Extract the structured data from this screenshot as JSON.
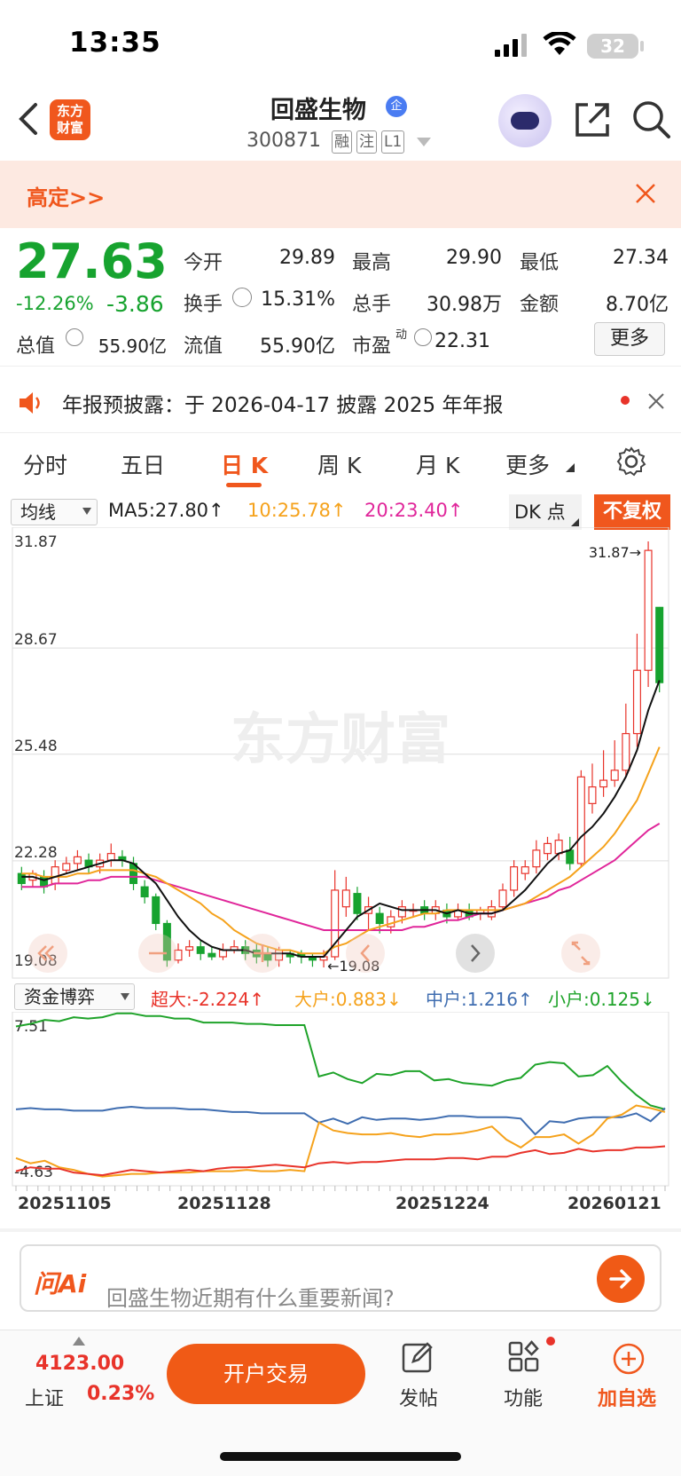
{
  "status_bar": {
    "time": "13:35",
    "battery": "32"
  },
  "header": {
    "logo_text_1": "东方",
    "logo_text_2": "财富",
    "stock_name": "回盛生物",
    "name_badge": "企",
    "stock_code": "300871",
    "tags": [
      "融",
      "注",
      "L1"
    ]
  },
  "banner": {
    "text": "高定>>"
  },
  "quote": {
    "price": "27.63",
    "change_pct": "-12.26%",
    "change": "-3.86",
    "fields": {
      "open_label": "今开",
      "open": "29.89",
      "high_label": "最高",
      "high": "29.90",
      "low_label": "最低",
      "low": "27.34",
      "turnover_label": "换手",
      "turnover": "15.31%",
      "volume_label": "总手",
      "volume": "30.98万",
      "amount_label": "金额",
      "amount": "8.70亿",
      "mcap_label": "总值",
      "mcap": "55.90亿",
      "float_label": "流值",
      "float": "55.90亿",
      "pe_label": "市盈",
      "pe_sup": "动",
      "pe": "22.31"
    },
    "more_button": "更多"
  },
  "notice": {
    "text": "年报预披露：于 2026-04-17 披露 2025 年年报"
  },
  "tabs": [
    "分时",
    "五日",
    "日 K",
    "周 K",
    "月 K",
    "更多"
  ],
  "active_tab": "日 K",
  "kline_toolbar": {
    "ma_select": "均线",
    "ma5": "MA5:27.80↑",
    "ma10": "10:25.78↑",
    "ma20": "20:23.40↑",
    "dk_button": "DK 点",
    "fq_button": "不复权"
  },
  "flow_toolbar": {
    "select": "资金博弈",
    "super": "超大:-2.224↑",
    "large": "大户:0.883↓",
    "medium": "中户:1.216↑",
    "small": "小户:0.125↓"
  },
  "watermark": "东方财富",
  "chart_data": [
    {
      "type": "candlestick",
      "y_ticks": [
        "31.87",
        "28.67",
        "25.48",
        "22.28",
        "19.08"
      ],
      "ylim": [
        19.08,
        31.87
      ],
      "max_label": "31.87→",
      "min_label": "←19.08",
      "candles": [
        {
          "o": 21.9,
          "c": 21.6,
          "h": 22.1,
          "l": 21.4
        },
        {
          "o": 21.7,
          "c": 21.9,
          "h": 22.0,
          "l": 21.5
        },
        {
          "o": 21.8,
          "c": 21.5,
          "h": 22.0,
          "l": 21.3
        },
        {
          "o": 21.6,
          "c": 22.1,
          "h": 22.3,
          "l": 21.4
        },
        {
          "o": 22.0,
          "c": 22.2,
          "h": 22.4,
          "l": 21.9
        },
        {
          "o": 22.2,
          "c": 22.4,
          "h": 22.6,
          "l": 22.0
        },
        {
          "o": 22.3,
          "c": 22.1,
          "h": 22.5,
          "l": 21.9
        },
        {
          "o": 22.1,
          "c": 22.3,
          "h": 22.5,
          "l": 21.9
        },
        {
          "o": 22.3,
          "c": 22.5,
          "h": 22.8,
          "l": 22.1
        },
        {
          "o": 22.4,
          "c": 22.3,
          "h": 22.6,
          "l": 22.1
        },
        {
          "o": 22.2,
          "c": 21.6,
          "h": 22.4,
          "l": 21.4
        },
        {
          "o": 21.5,
          "c": 21.2,
          "h": 21.7,
          "l": 21.0
        },
        {
          "o": 21.2,
          "c": 20.4,
          "h": 21.3,
          "l": 20.2
        },
        {
          "o": 20.4,
          "c": 19.3,
          "h": 20.5,
          "l": 19.1
        },
        {
          "o": 19.3,
          "c": 19.6,
          "h": 19.8,
          "l": 19.2
        },
        {
          "o": 19.6,
          "c": 19.7,
          "h": 19.9,
          "l": 19.4
        },
        {
          "o": 19.7,
          "c": 19.5,
          "h": 19.9,
          "l": 19.3
        },
        {
          "o": 19.5,
          "c": 19.4,
          "h": 19.7,
          "l": 19.3
        },
        {
          "o": 19.4,
          "c": 19.6,
          "h": 19.8,
          "l": 19.3
        },
        {
          "o": 19.6,
          "c": 19.7,
          "h": 19.9,
          "l": 19.5
        },
        {
          "o": 19.7,
          "c": 19.5,
          "h": 19.9,
          "l": 19.3
        },
        {
          "o": 19.6,
          "c": 19.4,
          "h": 19.8,
          "l": 19.2
        },
        {
          "o": 19.5,
          "c": 19.3,
          "h": 19.7,
          "l": 19.1
        },
        {
          "o": 19.3,
          "c": 19.6,
          "h": 19.7,
          "l": 19.1
        },
        {
          "o": 19.5,
          "c": 19.4,
          "h": 19.6,
          "l": 19.2
        },
        {
          "o": 19.5,
          "c": 19.4,
          "h": 19.6,
          "l": 19.2
        },
        {
          "o": 19.4,
          "c": 19.3,
          "h": 19.5,
          "l": 19.1
        },
        {
          "o": 19.3,
          "c": 19.4,
          "h": 19.6,
          "l": 19.08
        },
        {
          "o": 19.4,
          "c": 21.4,
          "h": 22.0,
          "l": 19.3
        },
        {
          "o": 20.9,
          "c": 21.4,
          "h": 21.8,
          "l": 20.6
        },
        {
          "o": 21.3,
          "c": 20.7,
          "h": 21.5,
          "l": 20.5
        },
        {
          "o": 20.7,
          "c": 20.9,
          "h": 21.2,
          "l": 20.2
        },
        {
          "o": 20.7,
          "c": 20.4,
          "h": 20.9,
          "l": 20.1
        },
        {
          "o": 20.3,
          "c": 20.6,
          "h": 20.8,
          "l": 20.1
        },
        {
          "o": 20.6,
          "c": 20.9,
          "h": 21.1,
          "l": 20.4
        },
        {
          "o": 20.8,
          "c": 20.8,
          "h": 21.0,
          "l": 20.6
        },
        {
          "o": 20.9,
          "c": 20.7,
          "h": 21.1,
          "l": 20.5
        },
        {
          "o": 20.7,
          "c": 20.9,
          "h": 21.1,
          "l": 20.5
        },
        {
          "o": 20.8,
          "c": 20.6,
          "h": 21.0,
          "l": 20.4
        },
        {
          "o": 20.6,
          "c": 20.8,
          "h": 21.0,
          "l": 20.5
        },
        {
          "o": 20.8,
          "c": 20.6,
          "h": 21.0,
          "l": 20.5
        },
        {
          "o": 20.7,
          "c": 20.8,
          "h": 20.9,
          "l": 20.5
        },
        {
          "o": 20.6,
          "c": 20.9,
          "h": 21.1,
          "l": 20.5
        },
        {
          "o": 20.9,
          "c": 21.4,
          "h": 21.6,
          "l": 20.8
        },
        {
          "o": 21.4,
          "c": 22.1,
          "h": 22.3,
          "l": 21.2
        },
        {
          "o": 21.9,
          "c": 22.1,
          "h": 22.3,
          "l": 21.7
        },
        {
          "o": 22.1,
          "c": 22.6,
          "h": 22.9,
          "l": 21.9
        },
        {
          "o": 22.5,
          "c": 22.8,
          "h": 23.0,
          "l": 22.3
        },
        {
          "o": 22.5,
          "c": 22.9,
          "h": 23.1,
          "l": 22.3
        },
        {
          "o": 22.6,
          "c": 22.2,
          "h": 23.0,
          "l": 22.0
        },
        {
          "o": 22.2,
          "c": 24.8,
          "h": 25.0,
          "l": 22.1
        },
        {
          "o": 24.0,
          "c": 24.5,
          "h": 25.2,
          "l": 23.7
        },
        {
          "o": 24.5,
          "c": 24.7,
          "h": 25.6,
          "l": 24.2
        },
        {
          "o": 24.7,
          "c": 25.0,
          "h": 25.9,
          "l": 24.5
        },
        {
          "o": 25.0,
          "c": 26.1,
          "h": 27.0,
          "l": 24.8
        },
        {
          "o": 26.1,
          "c": 28.0,
          "h": 29.1,
          "l": 25.7
        },
        {
          "o": 28.0,
          "c": 31.6,
          "h": 31.87,
          "l": 27.5
        },
        {
          "o": 29.89,
          "c": 27.63,
          "h": 29.9,
          "l": 27.34
        }
      ],
      "ma5": [
        21.8,
        21.8,
        21.7,
        21.8,
        21.9,
        22.0,
        22.1,
        22.2,
        22.3,
        22.3,
        22.2,
        21.9,
        21.6,
        21.1,
        20.6,
        20.2,
        19.9,
        19.7,
        19.6,
        19.6,
        19.6,
        19.5,
        19.5,
        19.5,
        19.5,
        19.4,
        19.4,
        19.4,
        19.8,
        20.2,
        20.6,
        20.8,
        21.0,
        20.9,
        20.8,
        20.8,
        20.8,
        20.8,
        20.7,
        20.8,
        20.7,
        20.7,
        20.7,
        20.8,
        21.1,
        21.4,
        21.8,
        22.2,
        22.5,
        22.6,
        23.0,
        23.3,
        23.7,
        24.2,
        24.8,
        25.6,
        26.8,
        27.7
      ],
      "ma10": [
        21.9,
        21.9,
        21.8,
        21.8,
        21.8,
        21.9,
        21.9,
        22.0,
        22.0,
        22.0,
        22.0,
        21.9,
        21.8,
        21.6,
        21.4,
        21.2,
        21.0,
        20.7,
        20.5,
        20.2,
        20.0,
        19.8,
        19.7,
        19.6,
        19.6,
        19.5,
        19.5,
        19.5,
        19.7,
        19.8,
        20.0,
        20.2,
        20.3,
        20.4,
        20.5,
        20.6,
        20.7,
        20.7,
        20.8,
        20.8,
        20.8,
        20.8,
        20.8,
        20.8,
        20.9,
        21.0,
        21.2,
        21.4,
        21.6,
        21.8,
        22.1,
        22.4,
        22.7,
        23.1,
        23.6,
        24.1,
        24.9,
        25.7
      ],
      "ma20": [
        21.5,
        21.5,
        21.5,
        21.6,
        21.6,
        21.6,
        21.7,
        21.7,
        21.8,
        21.8,
        21.8,
        21.8,
        21.7,
        21.6,
        21.5,
        21.4,
        21.3,
        21.2,
        21.1,
        21.0,
        20.9,
        20.8,
        20.7,
        20.6,
        20.5,
        20.4,
        20.3,
        20.2,
        20.2,
        20.2,
        20.2,
        20.2,
        20.2,
        20.2,
        20.2,
        20.3,
        20.3,
        20.4,
        20.5,
        20.5,
        20.6,
        20.7,
        20.7,
        20.8,
        20.9,
        21.0,
        21.1,
        21.2,
        21.4,
        21.5,
        21.7,
        21.9,
        22.1,
        22.3,
        22.6,
        22.9,
        23.2,
        23.4
      ]
    },
    {
      "type": "line",
      "y_ticks": [
        "7.51",
        "-4.63"
      ],
      "ylim": [
        -4.63,
        7.51
      ],
      "x_ticks": [
        "20251105",
        "20251128",
        "20251224",
        "20260121"
      ],
      "series": [
        {
          "name": "小户",
          "color": "#1fa32a",
          "values": [
            6.8,
            7.0,
            7.3,
            7.2,
            7.5,
            7.4,
            7.5,
            7.8,
            7.8,
            7.6,
            7.6,
            7.4,
            7.4,
            7.1,
            7.1,
            7.1,
            7.0,
            7.0,
            6.9,
            6.9,
            6.9,
            3.0,
            3.3,
            2.8,
            2.5,
            3.2,
            3.1,
            3.4,
            3.4,
            2.7,
            2.8,
            2.5,
            2.4,
            2.3,
            2.7,
            2.9,
            3.9,
            4.1,
            4.0,
            3.0,
            3.1,
            3.8,
            2.6,
            1.6,
            0.8,
            0.5
          ]
        },
        {
          "name": "中户",
          "color": "#3f6db0",
          "values": [
            0.5,
            0.6,
            0.5,
            0.5,
            0.4,
            0.4,
            0.4,
            0.6,
            0.7,
            0.6,
            0.6,
            0.6,
            0.5,
            0.5,
            0.4,
            0.3,
            0.3,
            0.2,
            0.2,
            0.2,
            0.2,
            -0.5,
            -0.2,
            -0.6,
            -0.1,
            -0.3,
            -0.2,
            -0.2,
            -0.3,
            -0.2,
            0.0,
            0.0,
            -0.1,
            -0.1,
            -0.1,
            -0.2,
            -1.4,
            -0.4,
            -0.5,
            -0.2,
            -0.1,
            -0.1,
            -0.1,
            0.2,
            -0.4,
            0.6
          ]
        },
        {
          "name": "大户",
          "color": "#f5a21c",
          "values": [
            -3.2,
            -3.6,
            -3.4,
            -3.9,
            -4.1,
            -4.4,
            -4.6,
            -4.5,
            -4.4,
            -4.4,
            -4.3,
            -4.3,
            -4.3,
            -4.2,
            -4.2,
            -4.2,
            -4.1,
            -4.2,
            -4.2,
            -4.1,
            -4.2,
            -0.5,
            -1.1,
            -1.3,
            -1.4,
            -1.4,
            -1.3,
            -1.5,
            -1.6,
            -1.4,
            -1.4,
            -1.3,
            -1.1,
            -0.8,
            -1.8,
            -2.4,
            -1.6,
            -1.6,
            -1.4,
            -2.1,
            -1.4,
            -0.2,
            0.1,
            0.8,
            0.6,
            0.3
          ]
        },
        {
          "name": "超大",
          "color": "#e8332a",
          "values": [
            -4.2,
            -3.9,
            -4.0,
            -4.0,
            -4.3,
            -4.4,
            -4.5,
            -4.3,
            -4.1,
            -4.2,
            -4.3,
            -4.2,
            -4.1,
            -4.2,
            -4.0,
            -3.9,
            -3.9,
            -3.8,
            -3.7,
            -3.8,
            -3.9,
            -3.6,
            -3.5,
            -3.6,
            -3.5,
            -3.5,
            -3.4,
            -3.3,
            -3.3,
            -3.3,
            -3.2,
            -3.2,
            -3.3,
            -3.1,
            -3.1,
            -2.8,
            -2.6,
            -2.9,
            -2.8,
            -2.5,
            -2.7,
            -2.6,
            -2.6,
            -2.4,
            -2.4,
            -2.3
          ]
        }
      ]
    }
  ],
  "ask_ai": {
    "logo": "问Ai",
    "placeholder": "回盛生物近期有什么重要新闻?"
  },
  "bottom": {
    "index_value": "4123.00",
    "index_name": "上证",
    "index_change": "0.23%",
    "trade_button": "开户交易",
    "nav": [
      "发帖",
      "功能",
      "加自选"
    ]
  }
}
